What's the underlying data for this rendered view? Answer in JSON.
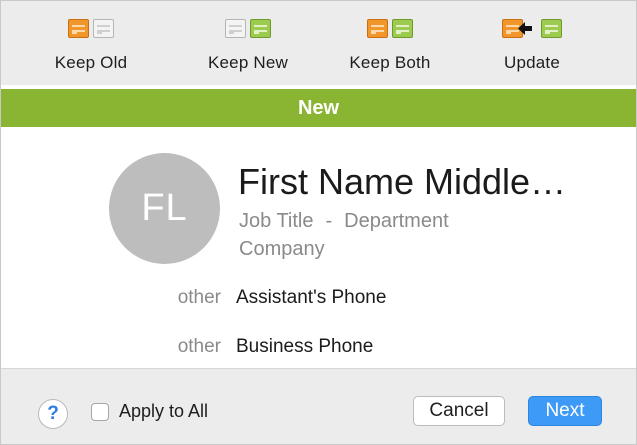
{
  "toolbar": {
    "keep_old": {
      "label": "Keep Old",
      "icons": [
        "orange-card-icon",
        "grey-card-icon"
      ]
    },
    "keep_new": {
      "label": "Keep New",
      "icons": [
        "grey-card-icon",
        "green-card-icon"
      ]
    },
    "keep_both": {
      "label": "Keep Both",
      "icons": [
        "orange-card-icon",
        "green-card-icon"
      ]
    },
    "update": {
      "label": "Update",
      "icons": [
        "orange-card-icon",
        "left-arrow-icon",
        "green-card-icon"
      ]
    }
  },
  "banner": {
    "title": "New"
  },
  "contact": {
    "initials": "FL",
    "name": "First Name Middle…",
    "job_title": "Job Title",
    "separator": "-",
    "department": "Department",
    "company": "Company",
    "fields": [
      {
        "type": "other",
        "value": "Assistant's Phone"
      },
      {
        "type": "other",
        "value": "Business Phone"
      }
    ]
  },
  "footer": {
    "help": "?",
    "apply_to_all": "Apply to All",
    "apply_to_all_checked": false,
    "cancel": "Cancel",
    "next": "Next"
  },
  "colors": {
    "banner": "#8ab533",
    "accent": "#3d9bf7",
    "orange_card": "#f0962a",
    "green_card": "#9ccb4f"
  }
}
